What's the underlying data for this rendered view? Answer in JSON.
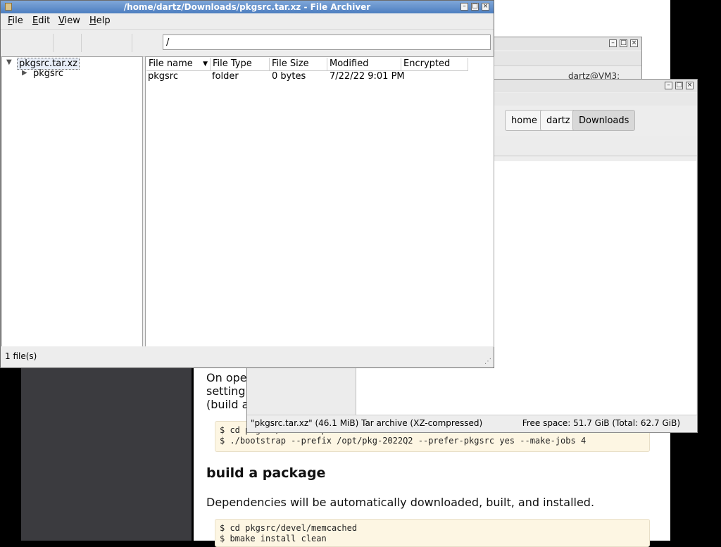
{
  "browser": {
    "para_line1": "On ope",
    "para_line2": "setting",
    "para_line3": "(build a",
    "code1_line1": "$ cd pkgsrc/bootstrap",
    "code1_line2": "$ ./bootstrap --prefix /opt/pkg-2022Q2 --prefer-pkgsrc yes --make-jobs 4",
    "heading": "build a package",
    "para2": "Dependencies will be automatically downloaded, built, and installed.",
    "code2_line1": "$ cd pkgsrc/devel/memcached",
    "code2_line2": "$ bmake install clean"
  },
  "terminal": {
    "prompt_fragment": "dartz@VM3:"
  },
  "file_manager": {
    "crumbs": [
      "home",
      "dartz",
      "Downloads"
    ],
    "status_left": "\"pkgsrc.tar.xz\" (46.1 MiB) Tar archive (XZ-compressed)",
    "status_right": "Free space: 51.7 GiB (Total: 62.7 GiB)"
  },
  "archiver": {
    "title": "/home/dartz/Downloads/pkgsrc.tar.xz - File Archiver",
    "menu": {
      "file": "File",
      "edit": "Edit",
      "view": "View",
      "help": "Help"
    },
    "location": "/",
    "tree": {
      "root": "pkgsrc.tar.xz",
      "child": "pkgsrc"
    },
    "columns": {
      "name": "File name",
      "type": "File Type",
      "size": "File Size",
      "modified": "Modified",
      "encrypted": "Encrypted"
    },
    "rows": [
      {
        "name": "pkgsrc",
        "type": "folder",
        "size": "0 bytes",
        "modified": "7/22/22 9:01 PM",
        "encrypted": ""
      }
    ],
    "status": "1 file(s)"
  }
}
